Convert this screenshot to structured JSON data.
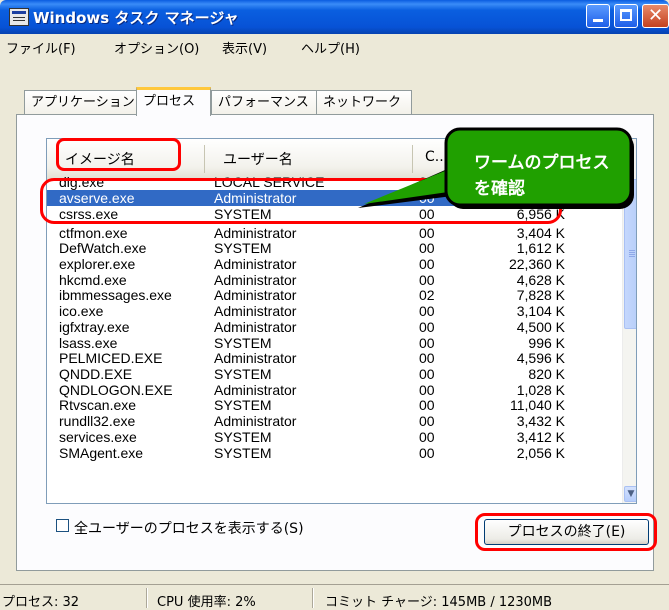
{
  "window": {
    "title": "Windows タスク マネージャ"
  },
  "menu": [
    "ファイル(F)",
    "オプション(O)",
    "表示(V)",
    "ヘルプ(H)"
  ],
  "tabs": [
    "アプリケーション",
    "プロセス",
    "パフォーマンス",
    "ネットワーク"
  ],
  "active_tab": "プロセス",
  "columns": {
    "name": "イメージ名",
    "user": "ユーザー名",
    "cpu": "C..."
  },
  "rows": [
    {
      "name": "dlg.exe",
      "user": "LOCAL SERVICE",
      "cpu": "00",
      "mem": ""
    },
    {
      "name": "avserve.exe",
      "user": "Administrator",
      "cpu": "00",
      "mem": ""
    },
    {
      "name": "csrss.exe",
      "user": "SYSTEM",
      "cpu": "00",
      "mem": "6,956 K"
    },
    {
      "name": "ctfmon.exe",
      "user": "Administrator",
      "cpu": "00",
      "mem": "3,404 K"
    },
    {
      "name": "DefWatch.exe",
      "user": "SYSTEM",
      "cpu": "00",
      "mem": "1,612 K"
    },
    {
      "name": "explorer.exe",
      "user": "Administrator",
      "cpu": "00",
      "mem": "22,360 K"
    },
    {
      "name": "hkcmd.exe",
      "user": "Administrator",
      "cpu": "00",
      "mem": "4,628 K"
    },
    {
      "name": "ibmmessages.exe",
      "user": "Administrator",
      "cpu": "02",
      "mem": "7,828 K"
    },
    {
      "name": "ico.exe",
      "user": "Administrator",
      "cpu": "00",
      "mem": "3,104 K"
    },
    {
      "name": "igfxtray.exe",
      "user": "Administrator",
      "cpu": "00",
      "mem": "4,500 K"
    },
    {
      "name": "lsass.exe",
      "user": "SYSTEM",
      "cpu": "00",
      "mem": "996 K"
    },
    {
      "name": "PELMICED.EXE",
      "user": "Administrator",
      "cpu": "00",
      "mem": "4,596 K"
    },
    {
      "name": "QNDD.EXE",
      "user": "SYSTEM",
      "cpu": "00",
      "mem": "820 K"
    },
    {
      "name": "QNDLOGON.EXE",
      "user": "Administrator",
      "cpu": "00",
      "mem": "1,028 K"
    },
    {
      "name": "Rtvscan.exe",
      "user": "SYSTEM",
      "cpu": "00",
      "mem": "11,040 K"
    },
    {
      "name": "rundll32.exe",
      "user": "Administrator",
      "cpu": "00",
      "mem": "3,432 K"
    },
    {
      "name": "services.exe",
      "user": "SYSTEM",
      "cpu": "00",
      "mem": "3,412 K"
    },
    {
      "name": "SMAgent.exe",
      "user": "SYSTEM",
      "cpu": "00",
      "mem": "2,056 K"
    }
  ],
  "selected_row": "avserve.exe",
  "show_all_users": {
    "label": "全ユーザーのプロセスを表示する(S)",
    "checked": false
  },
  "end_process_button": "プロセスの終了(E)",
  "callout": {
    "line1": "ワームのプロセス",
    "line2": "を確認"
  },
  "status": {
    "processes": "プロセス: 32",
    "cpu": "CPU 使用率: 2%",
    "commit": "コミット チャージ: 145MB / 1230MB"
  },
  "colors": {
    "selection": "#316ac5",
    "annotation_ring": "#ff0000",
    "callout_fill": "#20a000",
    "active_tab_accent": "#ffc83c"
  }
}
